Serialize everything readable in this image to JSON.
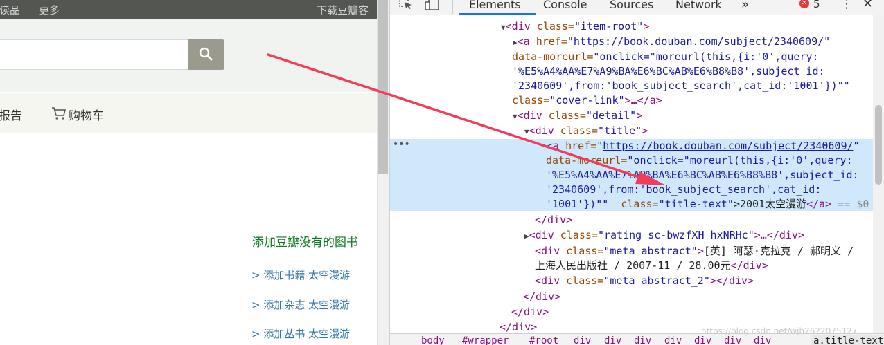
{
  "page": {
    "topnav": {
      "item_a": "读品",
      "item_b": "更多",
      "item_c": "下载豆瓣客"
    },
    "search": {
      "value": "",
      "button_icon": "search-icon"
    },
    "subnav": {
      "report": "报告",
      "cart": "购物车",
      "cart_icon": "cart-icon"
    },
    "add_section": {
      "title": "添加豆瓣没有的图书",
      "links": [
        "> 添加书籍 太空漫游",
        "> 添加杂志 太空漫游",
        "> 添加丛书 太空漫游"
      ]
    }
  },
  "devtools": {
    "tabs": [
      "Elements",
      "Console",
      "Sources",
      "Network"
    ],
    "active_tab": "Elements",
    "more_tabs": "»",
    "error_count": "5",
    "menu_icon": "⋮",
    "close_icon": "✕",
    "dom_lines": {
      "l1": {
        "tag": "<div ",
        "attr": "class=",
        "val": "\"item-root\"",
        "end": ">"
      },
      "l2": {
        "tag": "<a ",
        "attr": "href=",
        "q1": "\"",
        "link": "https://book.douban.com/subject/2340609/",
        "q2": "\""
      },
      "l3": {
        "attr": "data-moreurl=",
        "val": "\"onclick=\"moreurl(this,{i:'0',query:"
      },
      "l4": {
        "val": "'%E5%A4%AA%E7%A9%BA%E6%BC%AB%E6%B8%B8',subject_id:"
      },
      "l5": {
        "val": "'2340609',from:'book_subject_search',cat_id:'1001'})\"\""
      },
      "l6": {
        "attr": "class=",
        "val": "\"cover-link\"",
        "end": ">…</a>"
      },
      "l7": {
        "tag": "<div ",
        "attr": "class=",
        "val": "\"detail\"",
        "end": ">"
      },
      "l8": {
        "tag": "<div ",
        "attr": "class=",
        "val": "\"title\"",
        "end": ">"
      },
      "l9": {
        "tag": "<a ",
        "attr": "href=",
        "q1": "\"",
        "link": "https://book.douban.com/subject/2340609/",
        "q2": "\""
      },
      "l10": {
        "attr": "data-moreurl=",
        "val": "\"onclick=\"moreurl(this,{i:'0',query:"
      },
      "l11": {
        "val": "'%E5%A4%AA%E7%A9%BA%E6%BC%AB%E6%B8%B8',subject_id:"
      },
      "l12": {
        "val": "'2340609',from:'book_subject_search',cat_id:"
      },
      "l13": {
        "val": "'1001'})\"\"",
        "attr": "class=",
        "val2": "\"title-text\"",
        "text": ">2001太空漫游",
        "end": "</a>",
        "eq": " == $0"
      },
      "l14": {
        "end": "</div>"
      },
      "l15": {
        "tag": "<div ",
        "attr": "class=",
        "val": "\"rating sc-bwzfXH hxNRHc\"",
        "end": ">…</div>"
      },
      "l16": {
        "tag": "<div ",
        "attr": "class=",
        "val": "\"meta abstract\"",
        "text": "[英] 阿瑟·克拉克 / 郝明义 /"
      },
      "l17": {
        "text": "上海人民出版社 / 2007-11 / 28.00元",
        "end": "</div>"
      },
      "l18": {
        "tag": "<div ",
        "attr": "class=",
        "val": "\"meta abstract_2\"",
        "end": "></div>"
      },
      "l19": {
        "end": "</div>"
      },
      "l20": {
        "end": "</div>"
      },
      "l21": {
        "end": "</div>"
      }
    },
    "breadcrumbs": [
      "body",
      "#wrapper",
      "#root",
      "div",
      "div",
      "div",
      "div",
      "div",
      "div",
      "div",
      "a.title-text"
    ],
    "watermark": "https://blog.csdn.net/wjh2622075127"
  },
  "colors": {
    "arrow": "#f03e5a",
    "selection": "#cfe8fc",
    "tab_underline": "#1a73e8",
    "add_title": "#0a7a1f",
    "link": "#3377aa"
  }
}
